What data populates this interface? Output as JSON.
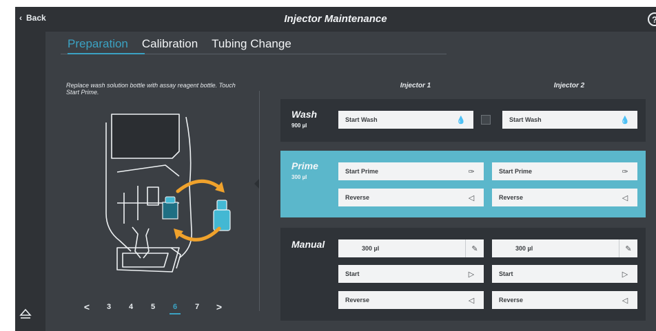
{
  "header": {
    "back_label": "Back",
    "title": "Injector Maintenance",
    "help_icon": "help-icon"
  },
  "tabs": [
    {
      "label": "Preparation",
      "active": true
    },
    {
      "label": "Calibration",
      "active": false
    },
    {
      "label": "Tubing Change",
      "active": false
    }
  ],
  "instruction": "Replace wash solution bottle with assay reagent bottle. Touch Start Prime.",
  "columns": {
    "injector1": "Injector 1",
    "injector2": "Injector 2"
  },
  "wash": {
    "label": "Wash",
    "volume": "900 µl",
    "inj1_button": "Start Wash",
    "inj2_button": "Start Wash"
  },
  "prime": {
    "label": "Prime",
    "volume": "300 µl",
    "inj1_start": "Start Prime",
    "inj2_start": "Start Prime",
    "inj1_reverse": "Reverse",
    "inj2_reverse": "Reverse"
  },
  "manual": {
    "label": "Manual",
    "inj1_volume": "300 µl",
    "inj2_volume": "300 µl",
    "inj1_start": "Start",
    "inj2_start": "Start",
    "inj1_reverse": "Reverse",
    "inj2_reverse": "Reverse"
  },
  "pager": {
    "prev": "<",
    "pages": [
      "3",
      "4",
      "5",
      "6",
      "7"
    ],
    "current": "6",
    "next": ">"
  },
  "colors": {
    "accent": "#3ba2c3",
    "prime_bg": "#5bb7cb",
    "bg": "#3b3f44",
    "bar": "#2f3236",
    "bottle": "#43b8d3",
    "arrow": "#f0a22c"
  }
}
